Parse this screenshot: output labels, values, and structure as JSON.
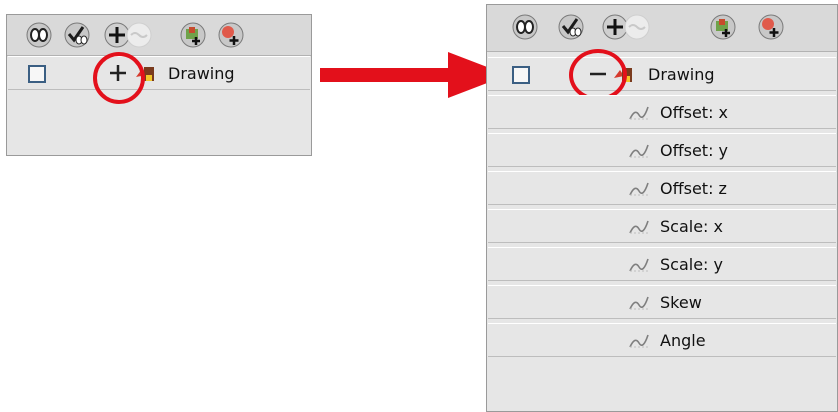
{
  "left_panel": {
    "node": {
      "label": "Drawing",
      "expander": "plus",
      "checked": false
    }
  },
  "right_panel": {
    "node": {
      "label": "Drawing",
      "expander": "minus",
      "checked": false
    },
    "children": [
      {
        "label": "Offset: x"
      },
      {
        "label": "Offset: y"
      },
      {
        "label": "Offset: z"
      },
      {
        "label": "Scale: x"
      },
      {
        "label": "Scale: y"
      },
      {
        "label": "Skew"
      },
      {
        "label": "Angle"
      }
    ]
  },
  "toolbar_icons": [
    "show-all-icon",
    "enable-all-icon",
    "add-icon",
    "disabled-function-icon",
    "add-layer-icon",
    "add-color-icon"
  ],
  "colors": {
    "highlight": "#e3101b",
    "panel": "#e6e6e6",
    "checkbox_border": "#3b5f83"
  }
}
